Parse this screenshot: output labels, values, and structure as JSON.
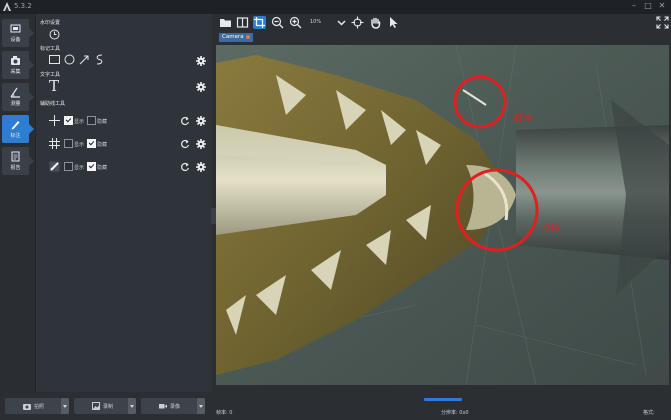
{
  "app": {
    "version": "5.3.2"
  },
  "nav": [
    {
      "key": "device",
      "label": "设备",
      "icon": "device-icon"
    },
    {
      "key": "capture",
      "label": "采集",
      "icon": "camera-icon"
    },
    {
      "key": "measure",
      "label": "测量",
      "icon": "measure-icon"
    },
    {
      "key": "annotate",
      "label": "标注",
      "icon": "pen-icon",
      "active": true
    },
    {
      "key": "report",
      "label": "报告",
      "icon": "report-icon"
    }
  ],
  "panel": {
    "watermark": {
      "title": "水印设置",
      "icon": "clock-icon"
    },
    "mark_tools": {
      "title": "标记工具",
      "tools": [
        "rectangle-icon",
        "circle-icon",
        "arrow-icon",
        "curve-icon"
      ]
    },
    "text_tool": {
      "title": "文字工具",
      "glyph": "T"
    },
    "guides": {
      "title": "辅助线工具",
      "rows": [
        {
          "icon": "crosshair-icon",
          "show_label": "显示",
          "show": true,
          "hide_label": "隐藏",
          "hide": false
        },
        {
          "icon": "grid-icon",
          "show_label": "显示",
          "show": false,
          "hide_label": "隐藏",
          "hide": true
        },
        {
          "icon": "ruler-icon",
          "show_label": "显示",
          "show": false,
          "hide_label": "隐藏",
          "hide": true
        }
      ]
    }
  },
  "bottom_buttons": [
    {
      "key": "photo",
      "label": "拍照",
      "icon": "camera-icon"
    },
    {
      "key": "record",
      "label": "录制",
      "icon": "image-icon"
    },
    {
      "key": "video",
      "label": "录像",
      "icon": "video-icon"
    }
  ],
  "toolbar": {
    "zoom": "10%"
  },
  "tab": {
    "label": "Camera"
  },
  "annotations": {
    "label1": "脏污",
    "label2": "崩边"
  },
  "status": {
    "frame": "帧率: 0",
    "resolution": "分辨率: 0x0",
    "format": "格式:"
  },
  "colors": {
    "accent": "#2d7dd2",
    "annotation": "#e02020"
  }
}
